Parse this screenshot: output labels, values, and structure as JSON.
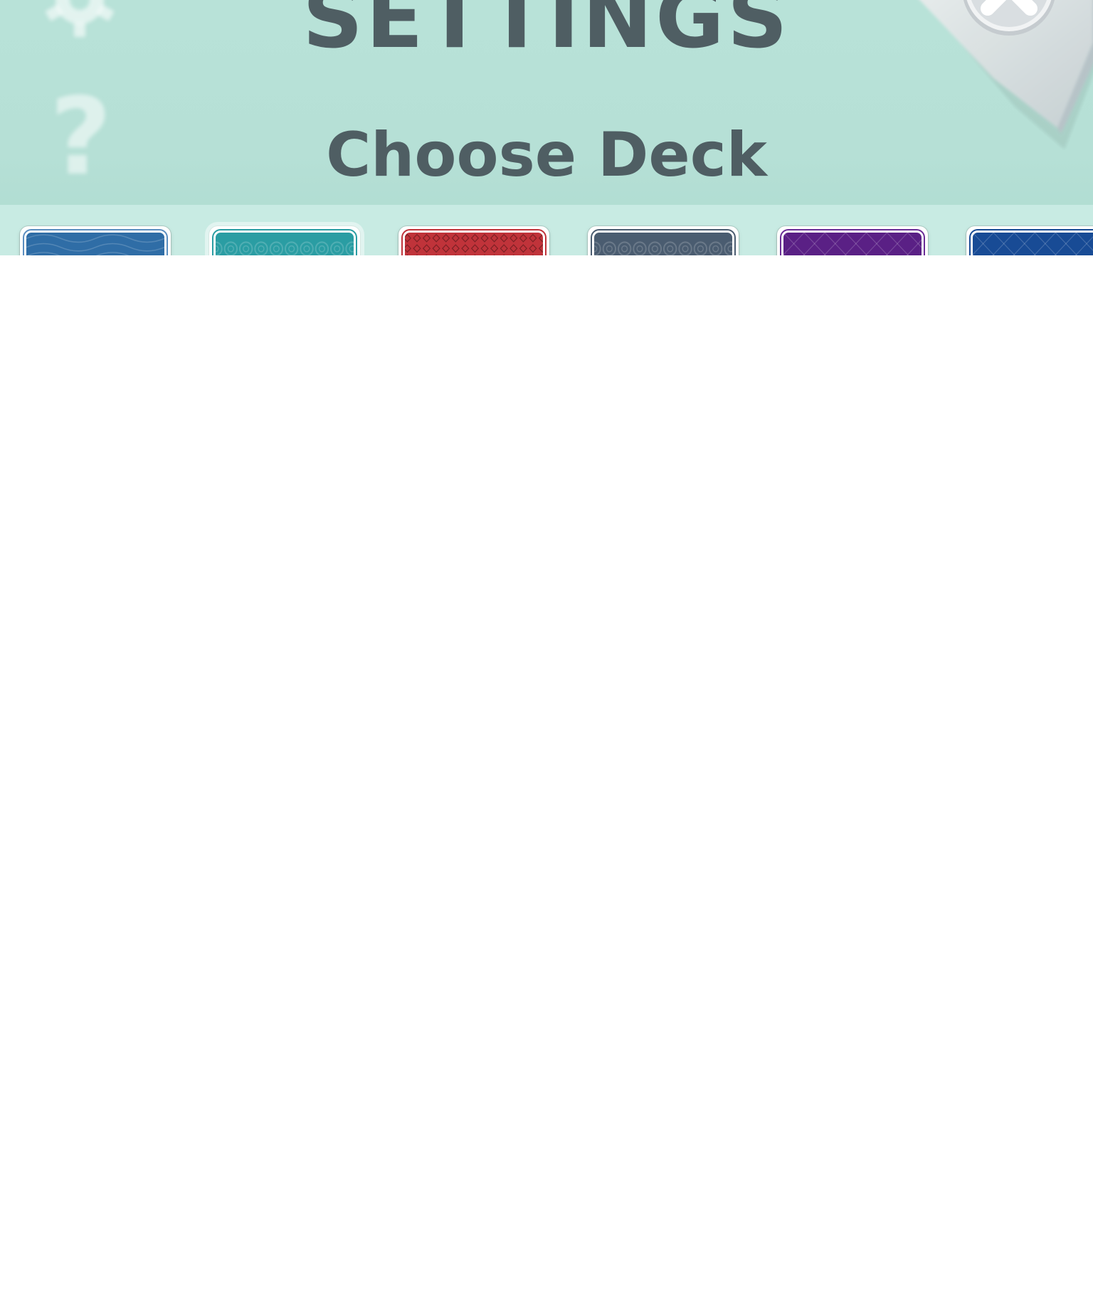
{
  "header": {
    "title": "SETTINGS",
    "subtitle": "Choose Deck"
  },
  "side_icons": {
    "top": "gear-icon",
    "bottom": "help-icon",
    "help_glyph": "?"
  },
  "close_button": {
    "icon": "close-icon"
  },
  "colors": {
    "panel_background": "#b8e2d8",
    "title_text": "#4f5e63",
    "deck_strip": "#c8ebe3"
  },
  "decks": [
    {
      "name": "blue-waves",
      "color": "#2f6da6",
      "edge": "#5b8ec0",
      "pattern": "waves",
      "selected": false
    },
    {
      "name": "teal-hex",
      "color": "#2a9da3",
      "edge": "#2a9da3",
      "pattern": "hex",
      "selected": true
    },
    {
      "name": "red-diamond",
      "color": "#c0333a",
      "edge": "#c0333a",
      "pattern": "diamond",
      "selected": false
    },
    {
      "name": "slate-hex",
      "color": "#4a5c70",
      "edge": "#4a5c70",
      "pattern": "hex",
      "selected": false
    },
    {
      "name": "purple-lines",
      "color": "#5a2085",
      "edge": "#6a2c96",
      "pattern": "lines",
      "selected": false
    },
    {
      "name": "navy-lines",
      "color": "#184b95",
      "edge": "#184b95",
      "pattern": "lines",
      "selected": false
    }
  ]
}
